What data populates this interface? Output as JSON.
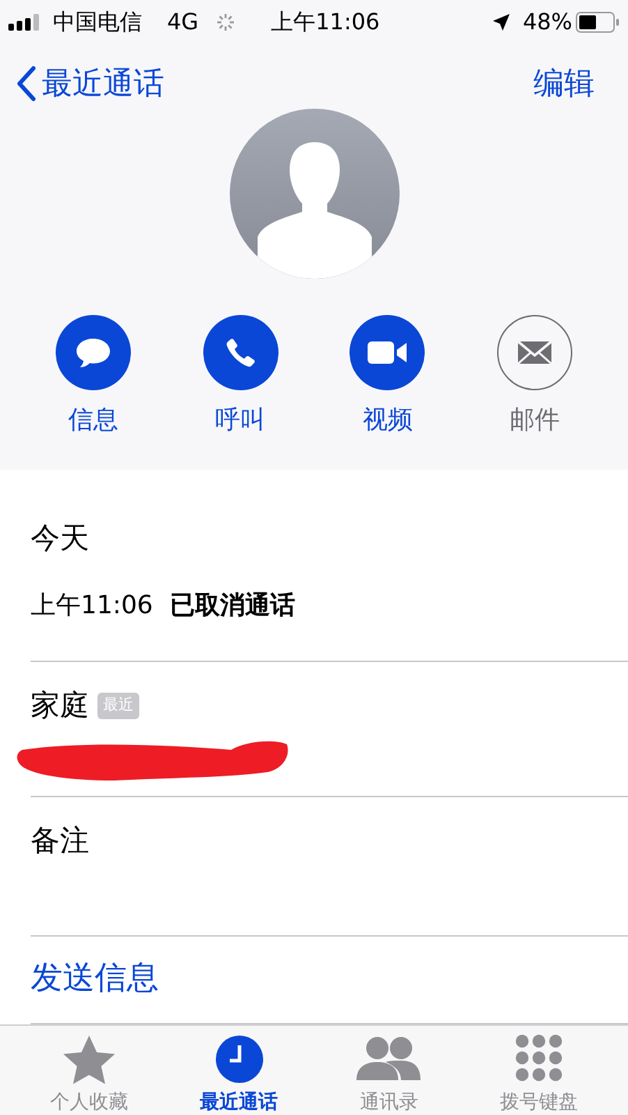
{
  "status_bar": {
    "carrier": "中国电信",
    "network": "4G",
    "time": "上午11:06",
    "battery": "48%"
  },
  "nav": {
    "back": "最近通话",
    "edit": "编辑"
  },
  "actions": [
    {
      "label": "信息",
      "kind": "message",
      "disabled": false
    },
    {
      "label": "呼叫",
      "kind": "call",
      "disabled": false
    },
    {
      "label": "视频",
      "kind": "video",
      "disabled": false
    },
    {
      "label": "邮件",
      "kind": "mail",
      "disabled": true
    }
  ],
  "recent": {
    "heading": "今天",
    "time": "上午11:06",
    "status": "已取消通话"
  },
  "phone": {
    "label": "家庭",
    "badge": "最近"
  },
  "notes": {
    "label": "备注"
  },
  "send_message": "发送信息",
  "tabs": [
    {
      "label": "个人收藏",
      "kind": "favorites",
      "selected": false
    },
    {
      "label": "最近通话",
      "kind": "recents",
      "selected": true
    },
    {
      "label": "通讯录",
      "kind": "contacts",
      "selected": false
    },
    {
      "label": "拨号键盘",
      "kind": "keypad",
      "selected": false
    }
  ]
}
